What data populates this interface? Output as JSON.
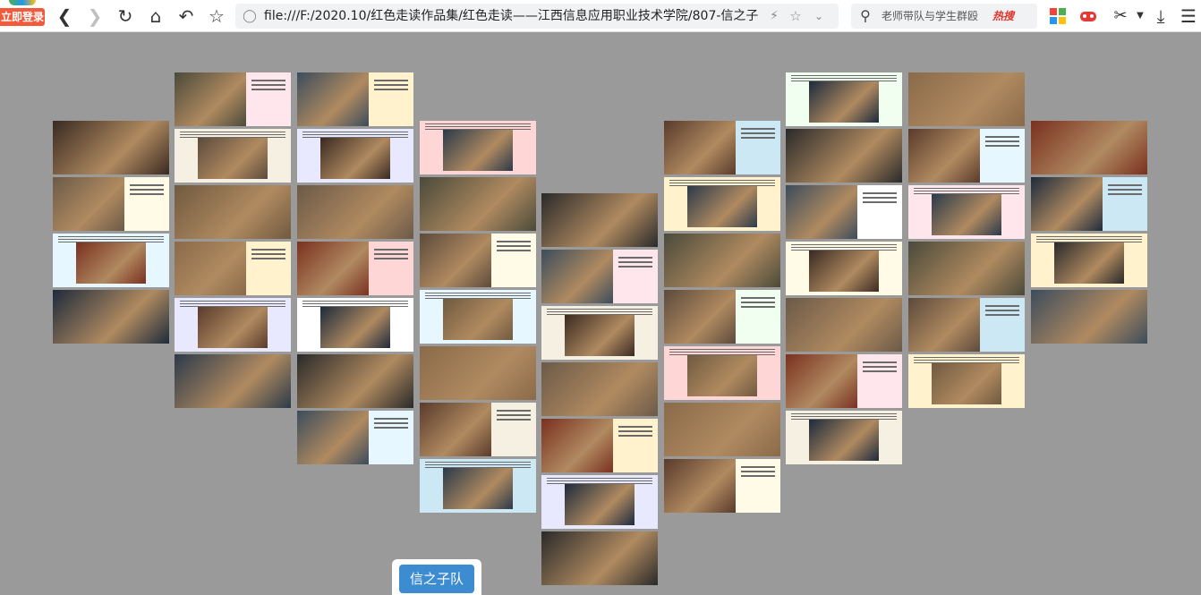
{
  "browser": {
    "login_label": "立即登录",
    "address": "file:///F:/2020.10/红色走读作品集/红色走读——江西信息应用职业技术学院/807-信之子",
    "search_placeholder": "老师带队与学生群殴",
    "hot_label": "热搜",
    "icons": [
      "back-icon",
      "forward-icon",
      "refresh-icon",
      "home-icon",
      "undo-icon",
      "star-icon",
      "shield-icon",
      "lightning-icon",
      "bookmark-star-icon",
      "dropdown-icon",
      "search-icon",
      "flame-icon",
      "apps-icon",
      "game-icon",
      "scissors-icon",
      "download-icon",
      "menu-icon"
    ]
  },
  "gallery": {
    "button_label": "信之子队",
    "accent": "#3d8bd0",
    "background": "#9a9a9a"
  }
}
